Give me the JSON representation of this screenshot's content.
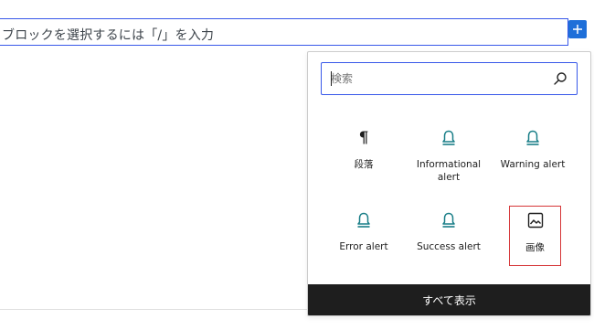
{
  "editor": {
    "block_placeholder": "ブロックを選択するには「/」を入力"
  },
  "add_block_button": {
    "icon": "plus-icon"
  },
  "inserter": {
    "search": {
      "placeholder": "検索",
      "icon": "search-icon"
    },
    "blocks": [
      {
        "label": "段落",
        "icon": "paragraph-icon"
      },
      {
        "label": "Informational alert",
        "icon": "bell-icon"
      },
      {
        "label": "Warning alert",
        "icon": "bell-icon"
      },
      {
        "label": "Error alert",
        "icon": "bell-icon"
      },
      {
        "label": "Success alert",
        "icon": "bell-icon"
      },
      {
        "label": "画像",
        "icon": "image-icon"
      }
    ],
    "show_all_label": "すべて表示"
  },
  "colors": {
    "accent_blue": "#3858e9",
    "add_button_blue": "#1e6fd9",
    "alert_icon_teal": "#1a7f88",
    "highlight_red": "#d63638",
    "footer_dark": "#1e1e1e"
  }
}
